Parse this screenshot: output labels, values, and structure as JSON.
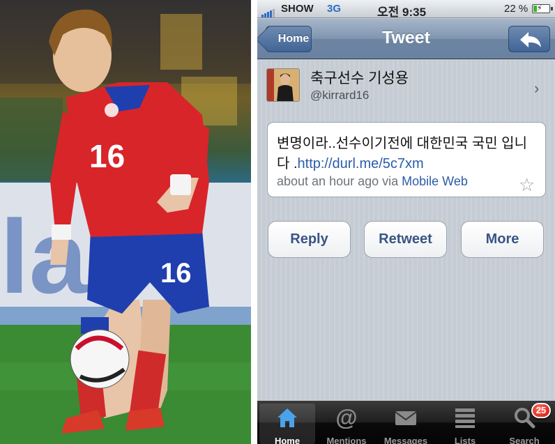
{
  "status_bar": {
    "carrier": "SHOW",
    "network": "3G",
    "time": "오전 9:35",
    "battery_percent": "22 %",
    "battery_level": 0.22
  },
  "nav": {
    "back_label": "Home",
    "title": "Tweet"
  },
  "tweet": {
    "user_name": "축구선수 기성용",
    "user_handle": "@kirrard16",
    "text": "변명이라..선수이기전에 대한민국 국민 입니다 .",
    "link": "http://durl.me/5c7xm",
    "time_ago": "about an hour ago via",
    "source": "Mobile Web"
  },
  "actions": {
    "reply": "Reply",
    "retweet": "Retweet",
    "more": "More"
  },
  "tabs": [
    {
      "label": "Home",
      "icon": "home-icon"
    },
    {
      "label": "Mentions",
      "icon": "at-icon"
    },
    {
      "label": "Messages",
      "icon": "envelope-icon"
    },
    {
      "label": "Lists",
      "icon": "lists-icon"
    },
    {
      "label": "Search",
      "icon": "search-icon"
    }
  ],
  "search_badge": "25",
  "photo": {
    "jersey_number": "16",
    "shorts_number": "16"
  },
  "colors": {
    "nav_blue": "#6d85a3",
    "link_blue": "#2a5da8",
    "jersey_red": "#d8252a",
    "shorts_blue": "#1f3fae",
    "badge_red": "#d2140a"
  }
}
